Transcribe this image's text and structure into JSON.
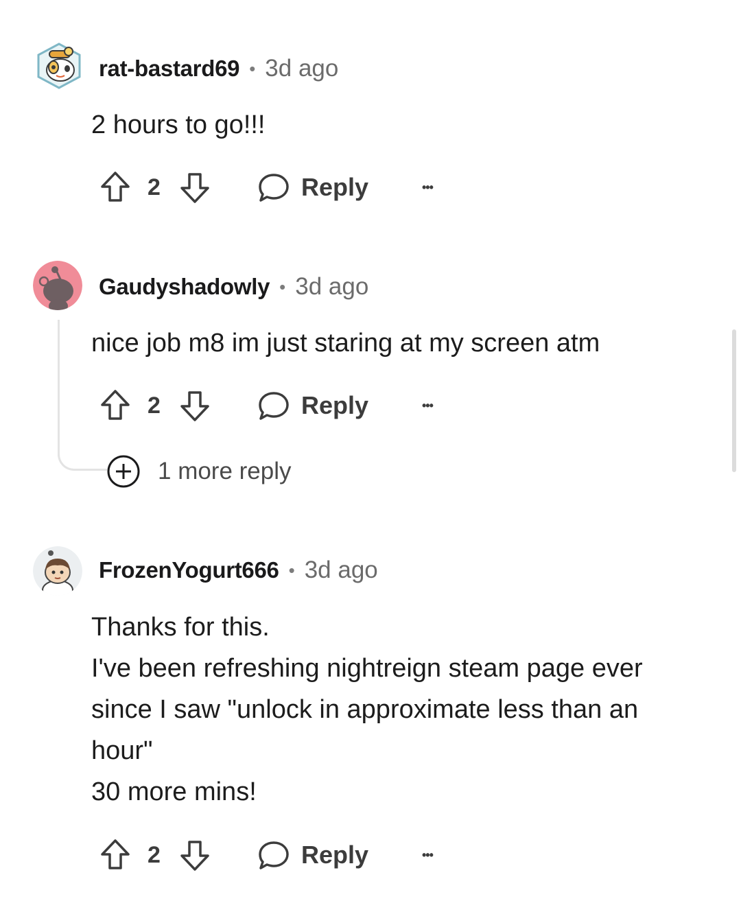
{
  "comments": [
    {
      "username": "rat-bastard69",
      "separator": "•",
      "time": "3d ago",
      "avatar_icon": "snoo-goggles-avatar-icon",
      "body": [
        "2 hours to go!!!"
      ],
      "votes": "2",
      "reply_label": "Reply",
      "more_label": "•••"
    },
    {
      "username": "Gaudyshadowly",
      "separator": "•",
      "time": "3d ago",
      "avatar_icon": "snoo-default-avatar-icon",
      "avatar_bg": "#f08c98",
      "body": [
        "nice job m8 im just staring at my screen atm"
      ],
      "votes": "2",
      "reply_label": "Reply",
      "more_label": "•••",
      "more_replies_label": "1 more reply"
    },
    {
      "username": "FrozenYogurt666",
      "separator": "•",
      "time": "3d ago",
      "avatar_icon": "snoo-character-avatar-icon",
      "body": [
        "Thanks for this.",
        "I've been refreshing nightreign steam page ever",
        "since I saw \"unlock in approximate less than an",
        "hour\"",
        "30 more mins!"
      ],
      "votes": "2",
      "reply_label": "Reply",
      "more_label": "•••"
    }
  ],
  "colors": {
    "text": "#1c1c1c",
    "muted": "#6b6b6b",
    "action": "#3c3c3c",
    "thread_line": "#e3e3e3"
  }
}
